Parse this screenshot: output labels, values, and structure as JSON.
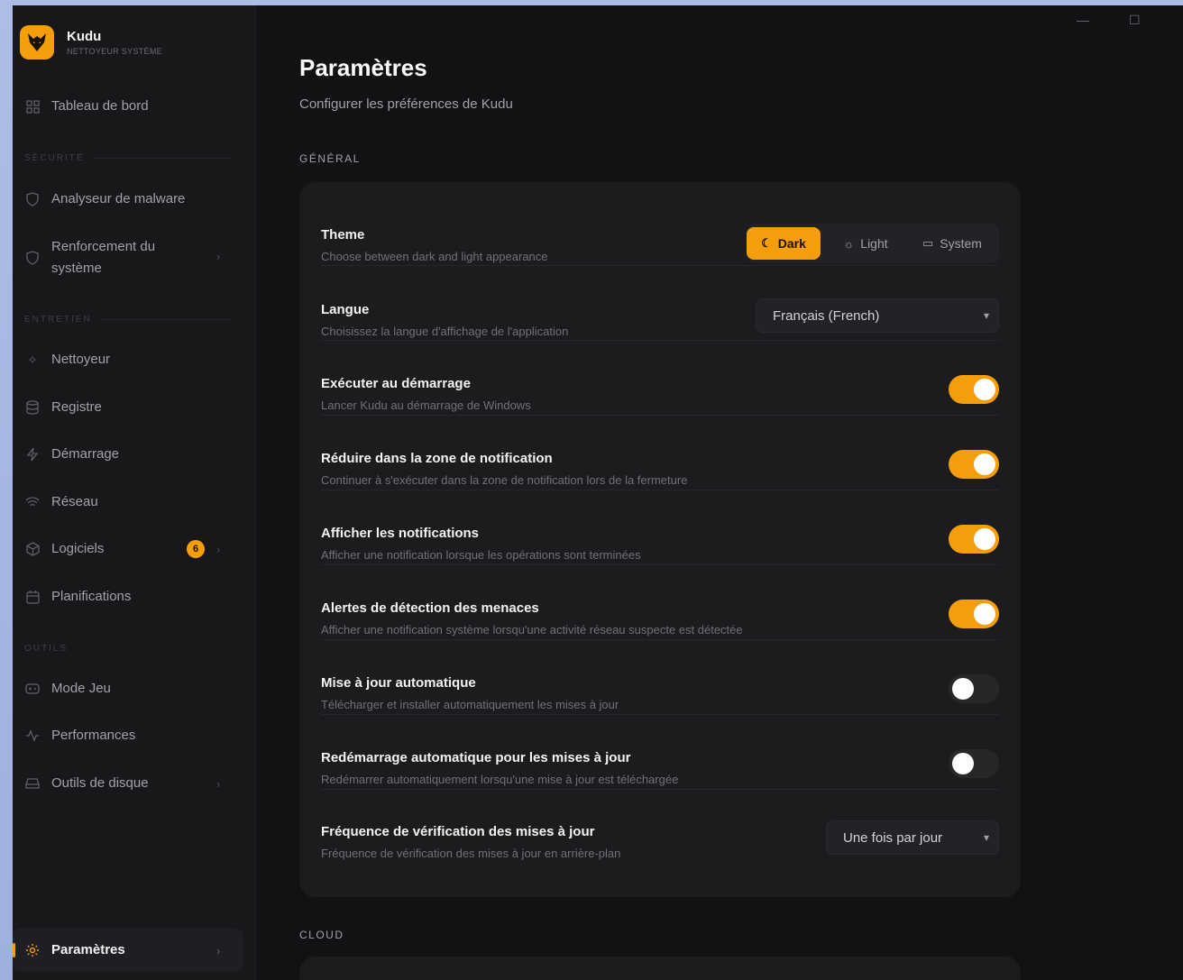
{
  "app": {
    "name": "Kudu",
    "subtitle": "NETTOYEUR SYSTÈME",
    "logo_icon": "fox-logo-icon",
    "accent": "#f59e0b"
  },
  "window_controls": {
    "minimize": "—",
    "maximize": "☐"
  },
  "sidebar": {
    "dashboard": {
      "label": "Tableau de bord",
      "icon": "grid-icon"
    },
    "sections": {
      "security": "SÉCURITÉ",
      "maintenance": "ENTRETIEN",
      "tools": "OUTILS"
    },
    "security_items": [
      {
        "label": "Analyseur de malware",
        "icon": "shield-icon"
      },
      {
        "label": "Renforcement du",
        "label2": "système",
        "icon": "shield-outline-icon"
      }
    ],
    "maintenance_items": [
      {
        "label": "Nettoyeur",
        "icon": "sparkles-icon"
      },
      {
        "label": "Registre",
        "icon": "database-icon"
      },
      {
        "label": "Démarrage",
        "icon": "lightning-icon"
      },
      {
        "label": "Réseau",
        "icon": "wifi-icon"
      },
      {
        "label": "Logiciels",
        "icon": "package-icon",
        "badge": "6"
      },
      {
        "label": "Planifications",
        "icon": "calendar-icon"
      }
    ],
    "tools_items": [
      {
        "label": "Mode Jeu",
        "icon": "gamepad-icon"
      },
      {
        "label": "Performances",
        "icon": "activity-icon"
      },
      {
        "label": "Outils de disque",
        "icon": "hard-drive-icon"
      }
    ],
    "settings": {
      "label": "Paramètres",
      "icon": "gear-icon"
    }
  },
  "main": {
    "title": "Paramètres",
    "subtitle": "Configurer les préférences de Kudu",
    "group_general": "GÉNÉRAL",
    "group_cloud": "CLOUD",
    "theme": {
      "title": "Theme",
      "desc": "Choose between dark and light appearance",
      "options": [
        {
          "label": "Dark",
          "icon": "moon-icon",
          "selected": true
        },
        {
          "label": "Light",
          "icon": "sun-icon",
          "selected": false
        },
        {
          "label": "System",
          "icon": "monitor-icon",
          "selected": false
        }
      ]
    },
    "language": {
      "title": "Langue",
      "desc": "Choisissez la langue d'affichage de l'application",
      "value": "Français (French)"
    },
    "toggles": [
      {
        "title": "Exécuter au démarrage",
        "desc": "Lancer Kudu au démarrage de Windows",
        "on": true
      },
      {
        "title": "Réduire dans la zone de notification",
        "desc": "Continuer à s'exécuter dans la zone de notification lors de la fermeture",
        "on": true
      },
      {
        "title": "Afficher les notifications",
        "desc": "Afficher une notification lorsque les opérations sont terminées",
        "on": true
      },
      {
        "title": "Alertes de détection des menaces",
        "desc": "Afficher une notification système lorsqu'une activité réseau suspecte est détectée",
        "on": true
      },
      {
        "title": "Mise à jour automatique",
        "desc": "Télécharger et installer automatiquement les mises à jour",
        "on": false
      },
      {
        "title": "Redémarrage automatique pour les mises à jour",
        "desc": "Redémarrer automatiquement lorsqu'une mise à jour est téléchargée",
        "on": false
      }
    ],
    "update_frequency": {
      "title": "Fréquence de vérification des mises à jour",
      "desc": "Fréquence de vérification des mises à jour en arrière-plan",
      "value": "Une fois par jour"
    }
  }
}
